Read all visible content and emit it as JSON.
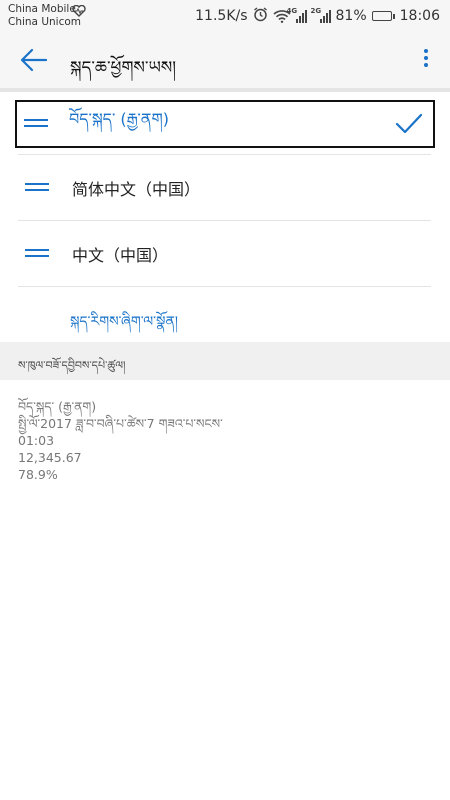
{
  "status_bar": {
    "carrier_1": "China Mobile",
    "carrier_2": "China Unicom",
    "net_speed": "11.5K/s",
    "sim1_tag": "4G",
    "sim2_tag": "2G",
    "battery_percent": "81%",
    "battery_level": 0.81,
    "time": "18:06"
  },
  "app_bar": {
    "title": "སྐད་ཆ་ཕྱོགས་ཡས།"
  },
  "languages": {
    "items": [
      {
        "label": "བོད་སྐད་ (རྒྱ་ནག)",
        "selected": true
      },
      {
        "label": "简体中文（中国）",
        "selected": false
      },
      {
        "label": "中文（中国）",
        "selected": false
      }
    ],
    "add_label": "སྐད་རིགས་ཞིག་ལ་སྣོན།"
  },
  "regional": {
    "header": "ས་ཁུལ་བཟོ་དབྱིབས་དཔེ་ཚུལ།",
    "lines": [
      "བོད་སྐད་ (རྒྱ་ནག)",
      "སྤྱི་ལོ་2017 ཟླ་བ་བཞི་པ་ཚེས་7 གཟའ་པ་སངས་",
      "01:03",
      "12,345.67",
      "78.9%"
    ]
  },
  "colors": {
    "accent": "#1a73c8",
    "bar_bg": "#f6f6f6"
  },
  "icons": {
    "back": "arrow-left-icon",
    "more": "more-vertical-icon",
    "drag": "drag-handle-icon",
    "check": "check-icon"
  }
}
